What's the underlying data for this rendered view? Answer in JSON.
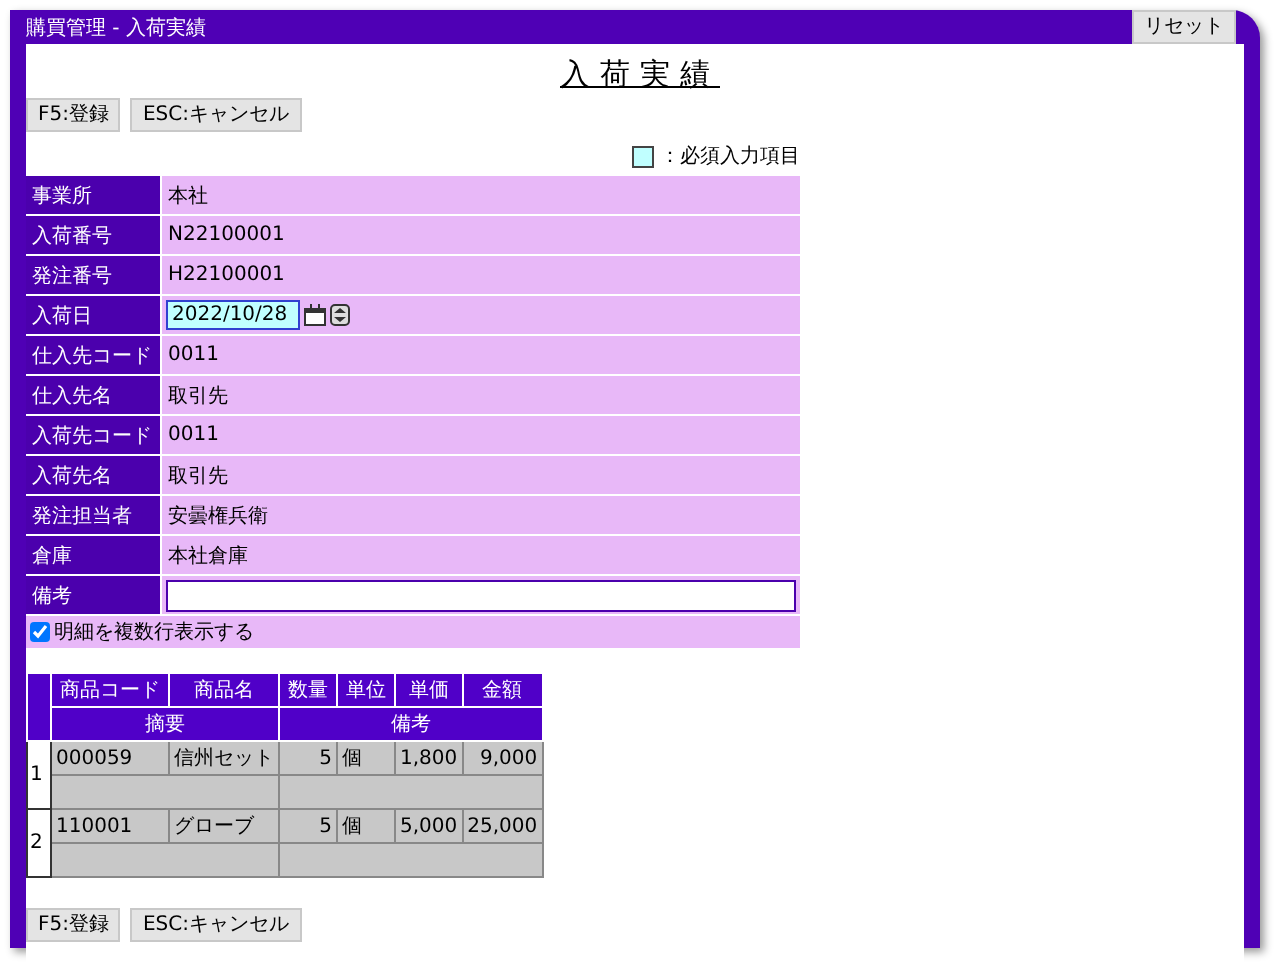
{
  "window": {
    "title": "購買管理 - 入荷実績",
    "reset_button": "リセット"
  },
  "heading": "入荷実績",
  "top_buttons": [
    "F5:登録",
    "ESC:キャンセル"
  ],
  "legend": "：必須入力項目",
  "form": [
    {
      "label": "事業所",
      "value": "本社",
      "kind": "text"
    },
    {
      "label": "入荷番号",
      "value": "N22100001",
      "kind": "text"
    },
    {
      "label": "発注番号",
      "value": "H22100001",
      "kind": "text"
    },
    {
      "label": "入荷日",
      "value": "2022/10/28",
      "kind": "date"
    },
    {
      "label": "仕入先コード",
      "value": "0011",
      "kind": "text"
    },
    {
      "label": "仕入先名",
      "value": "取引先",
      "kind": "text"
    },
    {
      "label": "入荷先コード",
      "value": "0011",
      "kind": "text"
    },
    {
      "label": "入荷先名",
      "value": "取引先",
      "kind": "text"
    },
    {
      "label": "発注担当者",
      "value": "安曇権兵衛",
      "kind": "text"
    },
    {
      "label": "倉庫",
      "value": "本社倉庫",
      "kind": "text"
    },
    {
      "label": "備考",
      "kind": "input"
    }
  ],
  "multiline_option": {
    "label": "明細を複数行表示する",
    "checked": true
  },
  "detail": {
    "columns": [
      "商品コード",
      "商品名",
      "数量",
      "単位",
      "単価",
      "金額"
    ],
    "sub_columns": [
      "摘要",
      "備考"
    ],
    "rows": [
      {
        "no": "1",
        "code": "000059",
        "name": "信州セット",
        "qty": "5",
        "unit": "個",
        "price": "1,800",
        "amount": "9,000"
      },
      {
        "no": "2",
        "code": "110001",
        "name": "グローブ",
        "qty": "5",
        "unit": "個",
        "price": "5,000",
        "amount": "25,000"
      }
    ]
  },
  "bottom_buttons": [
    "F5:登録",
    "ESC:キャンセル"
  ]
}
